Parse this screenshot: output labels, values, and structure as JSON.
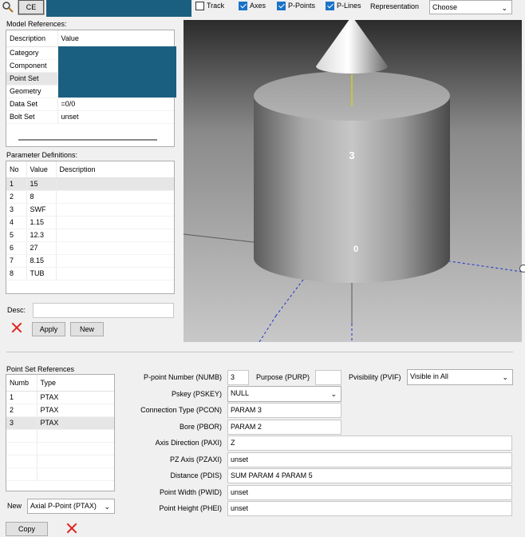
{
  "toolbar": {
    "ce_label": "CE",
    "track_label": "Track",
    "track_checked": false,
    "axes_label": "Axes",
    "axes_checked": true,
    "ppoints_label": "P-Points",
    "ppoints_checked": true,
    "plines_label": "P-Lines",
    "plines_checked": true,
    "representation_label": "Representation",
    "representation_value": "Choose"
  },
  "model_references": {
    "title": "Model References:",
    "headers": [
      "Description",
      "Value"
    ],
    "rows": [
      {
        "description": "Category",
        "value": ""
      },
      {
        "description": "Component",
        "value": ""
      },
      {
        "description": "Point Set",
        "value": ""
      },
      {
        "description": "Geometry",
        "value": ""
      },
      {
        "description": "Data Set",
        "value": "=0/0"
      },
      {
        "description": "Bolt Set",
        "value": "unset"
      }
    ]
  },
  "parameter_definitions": {
    "title": "Parameter Definitions:",
    "headers": [
      "No",
      "Value",
      "Description"
    ],
    "rows": [
      {
        "no": "1",
        "value": "15",
        "description": ""
      },
      {
        "no": "2",
        "value": "8",
        "description": ""
      },
      {
        "no": "3",
        "value": "SWF",
        "description": ""
      },
      {
        "no": "4",
        "value": "1.15",
        "description": ""
      },
      {
        "no": "5",
        "value": "12.3",
        "description": ""
      },
      {
        "no": "6",
        "value": "27",
        "description": ""
      },
      {
        "no": "7",
        "value": "8.15",
        "description": ""
      },
      {
        "no": "8",
        "value": "TUB",
        "description": ""
      }
    ]
  },
  "desc": {
    "label": "Desc:",
    "value": ""
  },
  "apply_label": "Apply",
  "new_label": "New",
  "viewport": {
    "point_label_top": "3",
    "point_label_bottom": "0",
    "colors": {
      "background_top": "#2b2b2b",
      "background_bottom": "#c4c4c4",
      "axis_blue": "#1a2fd0",
      "axis_yellow": "#d8d800"
    }
  },
  "point_set_references": {
    "title": "Point Set References",
    "headers": [
      "Numb",
      "Type"
    ],
    "rows": [
      {
        "numb": "1",
        "type": "PTAX"
      },
      {
        "numb": "2",
        "type": "PTAX"
      },
      {
        "numb": "3",
        "type": "PTAX"
      }
    ]
  },
  "new_type": {
    "label": "New",
    "value": "Axial P-Point (PTAX)"
  },
  "copy_label": "Copy",
  "properties": {
    "pnumber_label": "P-point Number (NUMB)",
    "pnumber_value": "3",
    "purpose_label": "Purpose (PURP)",
    "purpose_value": "",
    "pvis_label": "Pvisibility (PVIF)",
    "pvis_value": "Visible in All",
    "pskey_label": "Pskey (PSKEY)",
    "pskey_value": "NULL",
    "pcon_label": "Connection Type (PCON)",
    "pcon_value": "PARAM 3",
    "pbor_label": "Bore (PBOR)",
    "pbor_value": "PARAM 2",
    "paxi_label": "Axis Direction (PAXI)",
    "paxi_value": "Z",
    "pzaxi_label": "PZ Axis (PZAXI)",
    "pzaxi_value": "unset",
    "pdis_label": "Distance (PDIS)",
    "pdis_value": "SUM PARAM 4 PARAM 5",
    "pwid_label": "Point Width (PWID)",
    "pwid_value": "unset",
    "phei_label": "Point Height (PHEI)",
    "phei_value": "unset"
  },
  "colors": {
    "accent": "#1a73c8",
    "redacted": "#1b5f80",
    "delete_red": "#e0231f"
  }
}
